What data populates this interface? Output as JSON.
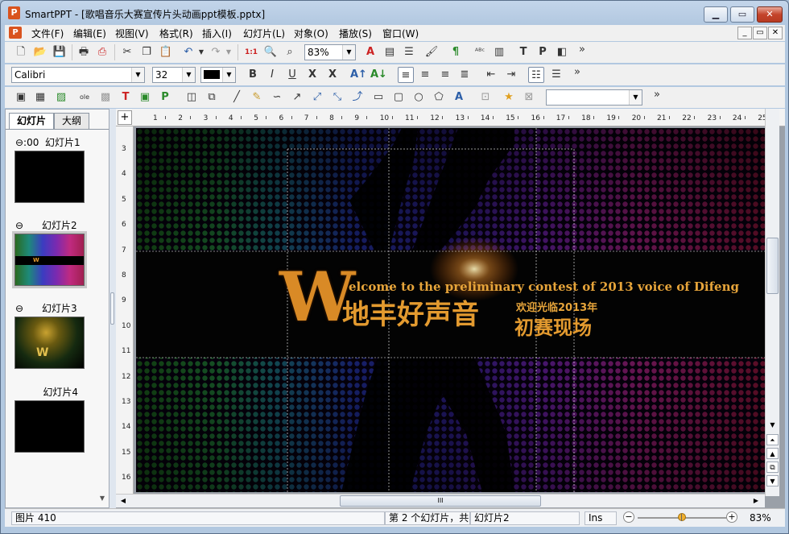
{
  "window": {
    "title": "SmartPPT - [歌唱音乐大赛宣传片头动画ppt模板.pptx]",
    "app_icon": "P"
  },
  "menu": [
    "文件(F)",
    "编辑(E)",
    "视图(V)",
    "格式(R)",
    "插入(I)",
    "幻灯片(L)",
    "对象(O)",
    "播放(S)",
    "窗口(W)"
  ],
  "toolbar": {
    "zoom": "83%",
    "more": "»"
  },
  "format": {
    "font": "Calibri",
    "size": "32",
    "more": "»"
  },
  "draw": {
    "shape_style": "",
    "more": "»"
  },
  "panel": {
    "tabs": [
      "幻灯片",
      "大纲"
    ],
    "slides": [
      {
        "marker": "⊖:00",
        "label": "幻灯片1"
      },
      {
        "marker": "⊖",
        "label": "幻灯片2"
      },
      {
        "marker": "⊖",
        "label": "幻灯片3"
      },
      {
        "marker": "",
        "label": "幻灯片4"
      }
    ]
  },
  "ruler": {
    "h": [
      "1",
      "2",
      "3",
      "4",
      "5",
      "6",
      "7",
      "8",
      "9",
      "10",
      "11",
      "12",
      "13",
      "14",
      "15",
      "16",
      "17",
      "18",
      "19",
      "20",
      "21",
      "22",
      "23",
      "24",
      "25"
    ],
    "v": [
      "3",
      "4",
      "5",
      "6",
      "7",
      "8",
      "9",
      "10",
      "11",
      "12",
      "13",
      "14",
      "15",
      "16"
    ]
  },
  "slide": {
    "banner_letter": "W",
    "banner_en": "elcome to the preliminary contest of 2013  voice of Difeng",
    "banner_cn": "地丰好声音",
    "banner_cn_small": "欢迎光临2013年",
    "banner_cn2": "初赛现场"
  },
  "status": {
    "object": "图片 410",
    "slide_info": "第 2 个幻灯片，共",
    "slide_name": "幻灯片2",
    "mode": "Ins",
    "zoom": "83%",
    "zoom_level": 0.5
  },
  "colors": {
    "accent": "#d9531e",
    "title_gold": "#e39a2f"
  }
}
